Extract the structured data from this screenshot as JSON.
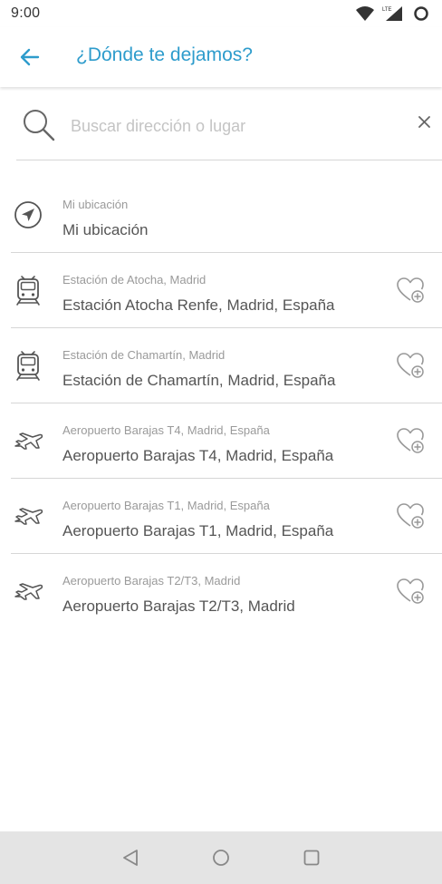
{
  "status_bar": {
    "time": "9:00",
    "network_label": "LTE"
  },
  "header": {
    "title": "¿Dónde te dejamos?"
  },
  "search": {
    "placeholder": "Buscar dirección o lugar",
    "value": ""
  },
  "places": [
    {
      "type": "location",
      "icon": "navigation-arrow-icon",
      "subtitle": "Mi ubicación",
      "title": "Mi ubicación",
      "favorite": false
    },
    {
      "type": "train",
      "icon": "train-icon",
      "subtitle": "Estación de Atocha, Madrid",
      "title": "Estación Atocha Renfe, Madrid, España",
      "favorite": true
    },
    {
      "type": "train",
      "icon": "train-icon",
      "subtitle": "Estación de Chamartín, Madrid",
      "title": "Estación de Chamartín, Madrid, España",
      "favorite": true
    },
    {
      "type": "airport",
      "icon": "airplane-icon",
      "subtitle": "Aeropuerto Barajas T4, Madrid, España",
      "title": "Aeropuerto Barajas T4, Madrid, España",
      "favorite": true
    },
    {
      "type": "airport",
      "icon": "airplane-icon",
      "subtitle": "Aeropuerto Barajas T1, Madrid, España",
      "title": "Aeropuerto Barajas T1, Madrid, España",
      "favorite": true
    },
    {
      "type": "airport",
      "icon": "airplane-icon",
      "subtitle": "Aeropuerto Barajas T2/T3, Madrid",
      "title": "Aeropuerto Barajas T2/T3, Madrid",
      "favorite": true
    }
  ],
  "colors": {
    "accent": "#2e9ccc",
    "icon_gray": "#555555",
    "divider": "#d6d6d6",
    "nav_bar": "#e4e4e4"
  }
}
